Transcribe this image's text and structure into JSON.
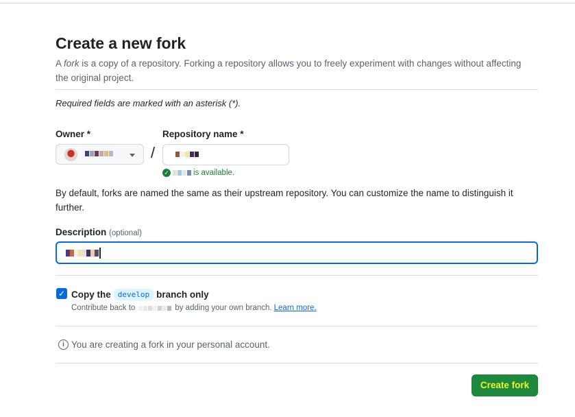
{
  "page": {
    "title": "Create a new fork",
    "subtitle_pre": "A ",
    "subtitle_em": "fork",
    "subtitle_post": " is a copy of a repository. Forking a repository allows you to freely experiment with changes without affecting the original project.",
    "required_note": "Required fields are marked with an asterisk (*)."
  },
  "form": {
    "owner_label": "Owner *",
    "repo_label": "Repository name *",
    "slash": "/",
    "availability_suffix": "is available.",
    "default_note": "By default, forks are named the same as their upstream repository. You can customize the name to distinguish it further.",
    "description_label": "Description",
    "description_optional": "(optional)",
    "copy_prefix": "Copy the",
    "branch_name": "develop",
    "copy_suffix": "branch only",
    "contribute_prefix": "Contribute back to",
    "contribute_suffix": "by adding your own branch.",
    "learn_more": "Learn more.",
    "info_text": "You are creating a fork in your personal account.",
    "create_button": "Create fork"
  },
  "icons": {
    "check": "check-circle-icon",
    "info": "info-icon",
    "caret": "triangle-down-icon"
  },
  "colors": {
    "primary_button": "#1f883d",
    "primary_button_text": "#eaf72c",
    "link": "#0969da",
    "success": "#1a7f37"
  }
}
